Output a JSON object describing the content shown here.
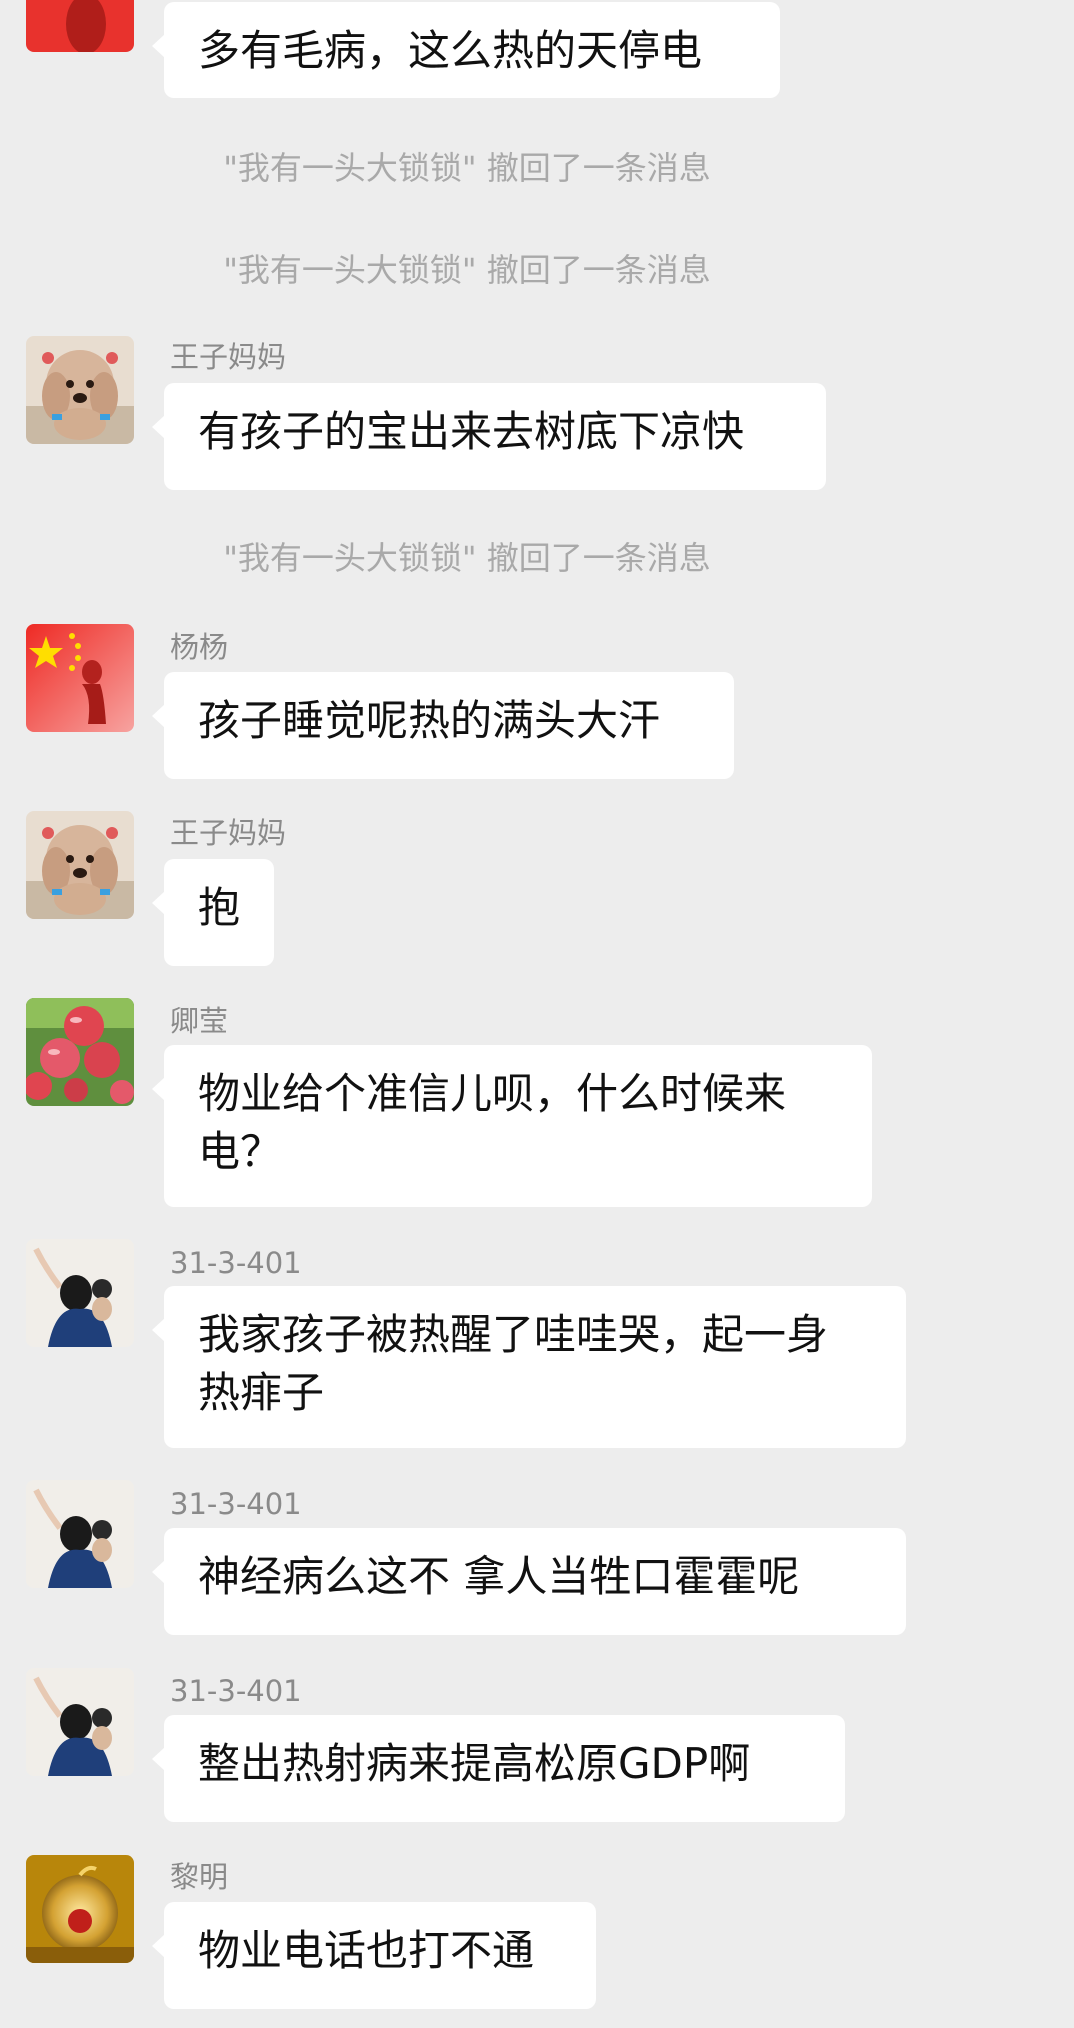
{
  "colors": {
    "background": "#ededed",
    "bubble": "#ffffff",
    "sender_name": "#8a8a8a",
    "system_notice": "#a9a9a9",
    "message_text": "#111111"
  },
  "messages": [
    {
      "type": "text",
      "avatar": "flag-avatar",
      "text": "多有毛病，这么热的天停电"
    },
    {
      "type": "system",
      "text": "\"我有一头大锁锁\" 撤回了一条消息"
    },
    {
      "type": "system",
      "text": "\"我有一头大锁锁\" 撤回了一条消息"
    },
    {
      "type": "text",
      "sender": "王子妈妈",
      "avatar": "poodle-avatar",
      "text": "有孩子的宝出来去树底下凉快"
    },
    {
      "type": "system",
      "text": "\"我有一头大锁锁\" 撤回了一条消息"
    },
    {
      "type": "text",
      "sender": "杨杨",
      "avatar": "flag-avatar",
      "text": "孩子睡觉呢热的满头大汗"
    },
    {
      "type": "text",
      "sender": "王子妈妈",
      "avatar": "poodle-avatar",
      "text": "抱"
    },
    {
      "type": "text",
      "sender": "卿莹",
      "avatar": "apple-avatar",
      "text_lines": [
        "物业给个准信儿呗，什么时候来",
        "电？"
      ]
    },
    {
      "type": "text",
      "sender": "31-3-401",
      "avatar": "mother-child-avatar",
      "text_lines": [
        "我家孩子被热醒了哇哇哭，起一身",
        "热痱子"
      ]
    },
    {
      "type": "text",
      "sender": "31-3-401",
      "avatar": "mother-child-avatar",
      "text": "神经病么这不 拿人当牲口霍霍呢"
    },
    {
      "type": "text",
      "sender": "31-3-401",
      "avatar": "mother-child-avatar",
      "text": "整出热射病来提高松原GDP啊"
    },
    {
      "type": "text",
      "sender": "黎明",
      "avatar": "gold-ornament-avatar",
      "text": "物业电话也打不通"
    }
  ]
}
